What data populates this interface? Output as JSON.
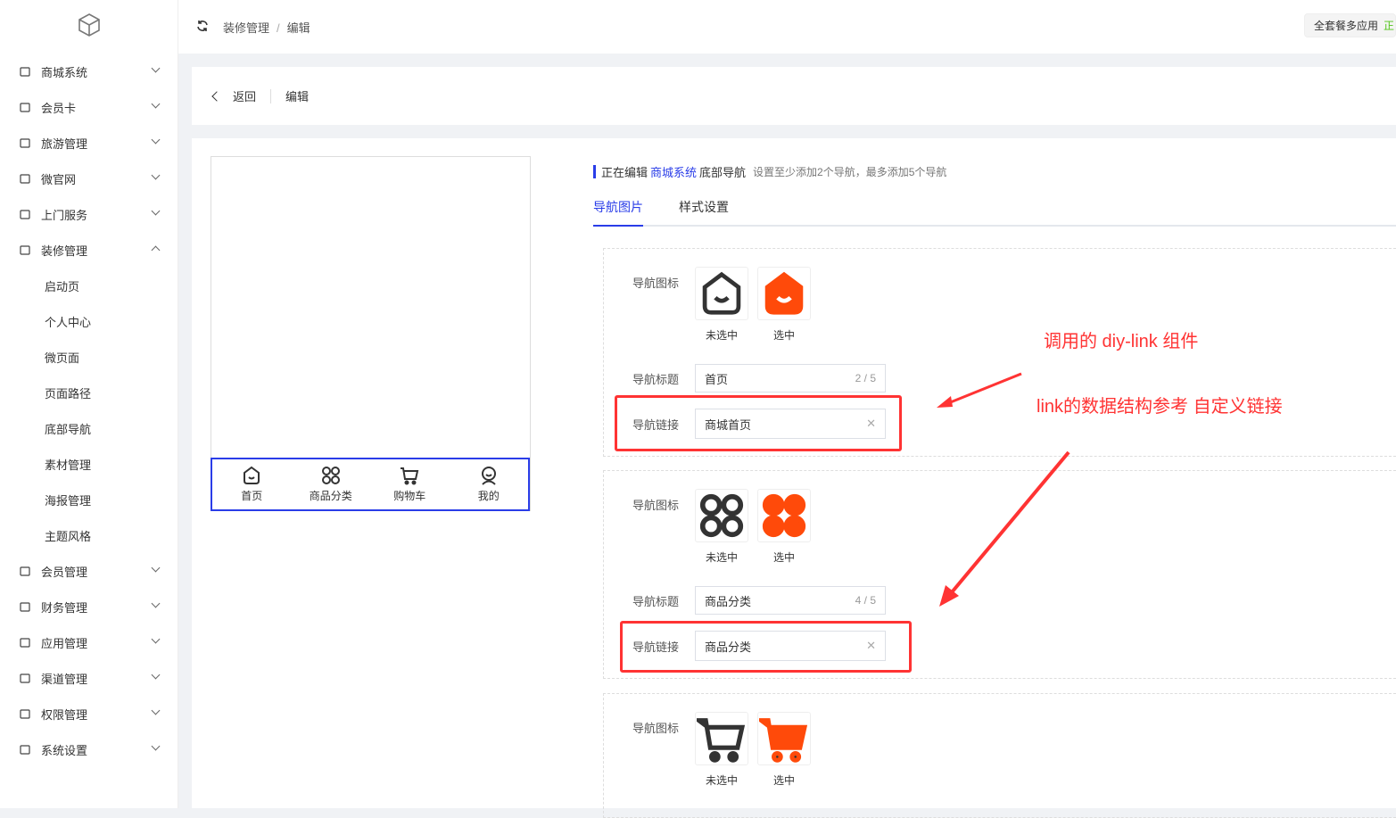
{
  "sidebar": {
    "items": [
      {
        "label": "商城系统",
        "icon": "shopping-bag-icon"
      },
      {
        "label": "会员卡",
        "icon": "member-card-icon"
      },
      {
        "label": "旅游管理",
        "icon": "travel-icon"
      },
      {
        "label": "微官网",
        "icon": "globe-icon"
      },
      {
        "label": "上门服务",
        "icon": "service-icon"
      },
      {
        "label": "装修管理",
        "icon": "decorate-icon",
        "expanded": true
      }
    ],
    "sub": [
      "启动页",
      "个人中心",
      "微页面",
      "页面路径",
      "底部导航",
      "素材管理",
      "海报管理",
      "主题风格"
    ],
    "items2": [
      {
        "label": "会员管理",
        "icon": "heart-icon"
      },
      {
        "label": "财务管理",
        "icon": "finance-icon"
      },
      {
        "label": "应用管理",
        "icon": "app-icon"
      },
      {
        "label": "渠道管理",
        "icon": "channel-icon"
      },
      {
        "label": "权限管理",
        "icon": "lock-icon"
      },
      {
        "label": "系统设置",
        "icon": "gear-icon"
      }
    ]
  },
  "header": {
    "breadcrumb": [
      "装修管理",
      "编辑"
    ],
    "plan": "全套餐多应用",
    "plan_status": "正常"
  },
  "page": {
    "back": "返回",
    "title": "编辑"
  },
  "preview": {
    "tabs": [
      "首页",
      "商品分类",
      "购物车",
      "我的"
    ]
  },
  "editor": {
    "prefix": "正在编辑",
    "system": "商城系统",
    "target": "底部导航",
    "hint": "设置至少添加2个导航，最多添加5个导航",
    "tabs": [
      "导航图片",
      "样式设置"
    ],
    "labels": {
      "icon": "导航图标",
      "title": "导航标题",
      "link": "导航链接",
      "unselected": "未选中",
      "selected": "选中"
    },
    "items": [
      {
        "title": "首页",
        "count": "2 / 5",
        "link": "商城首页"
      },
      {
        "title": "商品分类",
        "count": "4 / 5",
        "link": "商品分类"
      },
      {}
    ]
  },
  "annotations": [
    "调用的 diy-link 组件",
    "link的数据结构参考 自定义链接"
  ],
  "colors": {
    "accent": "#2a3de8",
    "active_icon": "#ff4a0a",
    "annotation": "#ff3333"
  }
}
